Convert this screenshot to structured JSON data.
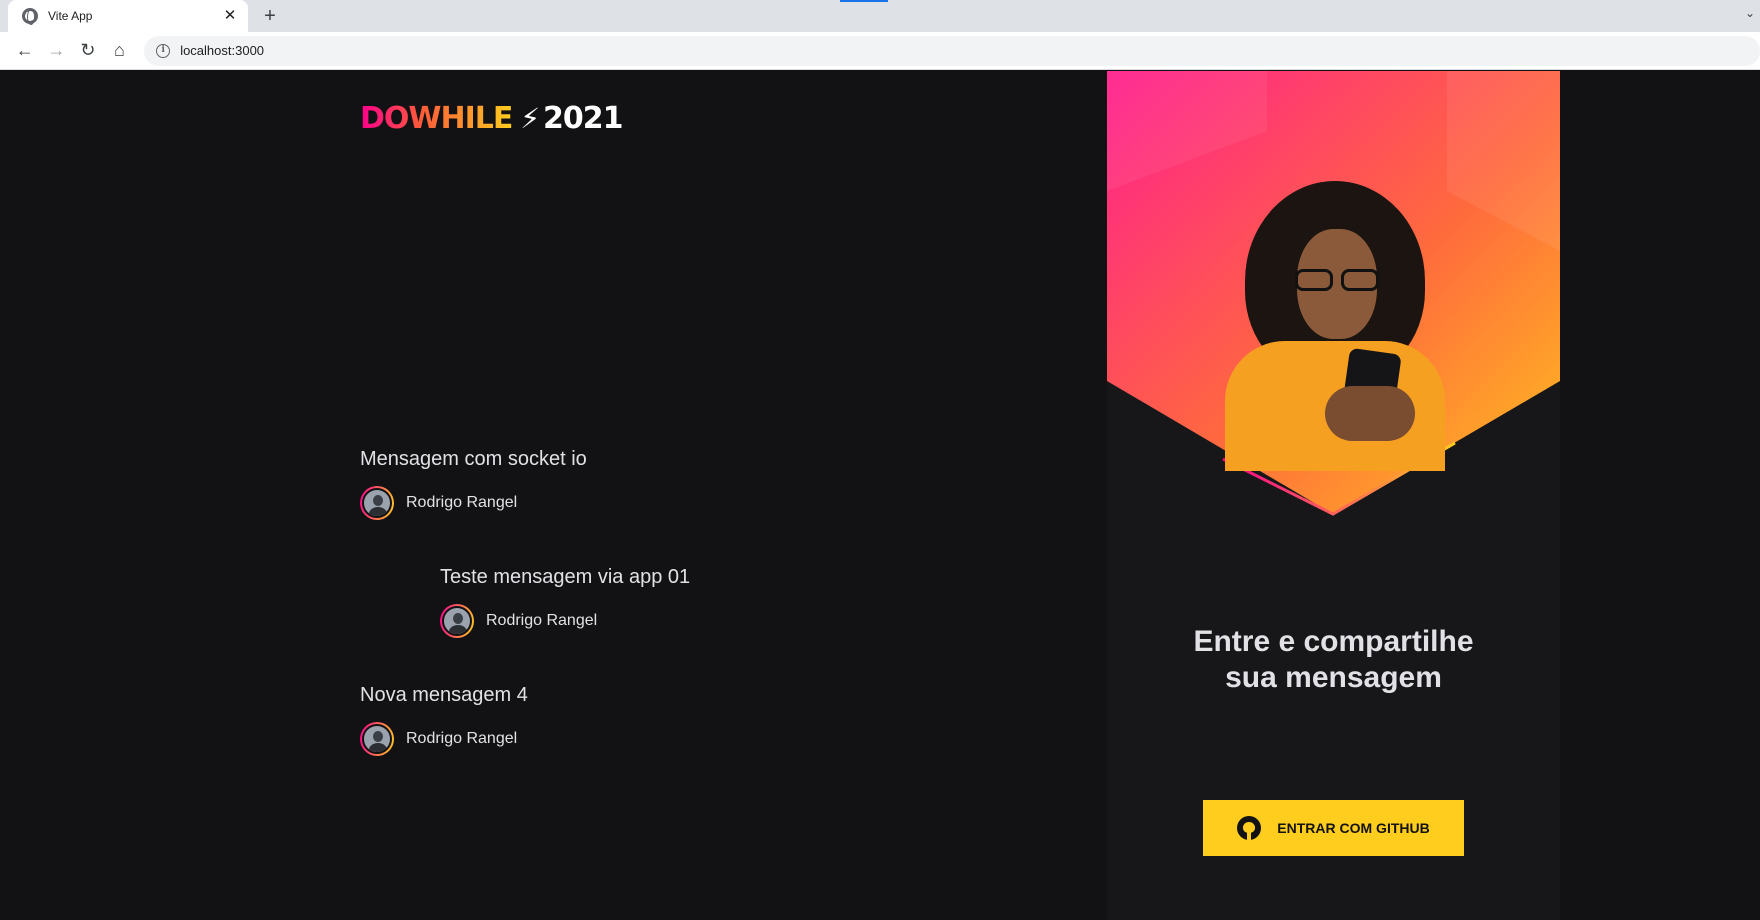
{
  "browser": {
    "tab_title": "Vite App",
    "url": "localhost:3000"
  },
  "logo": {
    "brand": "DOWHILE",
    "spark": "⚡",
    "year": "2021"
  },
  "messages": [
    {
      "content": "Mensagem com socket io",
      "user": "Rodrigo Rangel"
    },
    {
      "content": "Teste mensagem via app 01",
      "user": "Rodrigo Rangel"
    },
    {
      "content": "Nova mensagem 4",
      "user": "Rodrigo Rangel"
    }
  ],
  "login": {
    "title_line1": "Entre e compartilhe",
    "title_line2": "sua mensagem",
    "button_label": "ENTRAR COM GITHUB"
  },
  "icons": {
    "tab_favicon": "globe-icon",
    "tab_close": "close-icon",
    "new_tab": "plus-icon",
    "back": "arrow-left-icon",
    "forward": "arrow-right-icon",
    "reload": "reload-icon",
    "home": "home-icon",
    "site_info": "info-icon",
    "github": "github-icon"
  },
  "colors": {
    "background": "#121214",
    "panel": "#17171a",
    "text": "#e1e1e6",
    "brand_pink": "#ff008e",
    "brand_yellow": "#ffcd1e"
  }
}
